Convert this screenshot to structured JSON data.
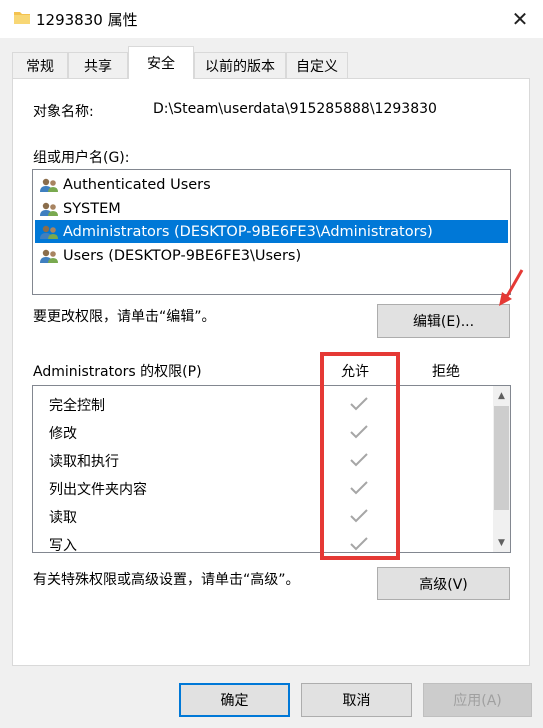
{
  "window": {
    "title": "1293830 属性",
    "close_glyph": "✕"
  },
  "tabs": [
    {
      "label": "常规"
    },
    {
      "label": "共享"
    },
    {
      "label": "安全"
    },
    {
      "label": "以前的版本"
    },
    {
      "label": "自定义"
    }
  ],
  "object": {
    "label": "对象名称:",
    "value": "D:\\Steam\\userdata\\915285888\\1293830"
  },
  "groups": {
    "label": "组或用户名(G):",
    "items": [
      {
        "label": "Authenticated Users"
      },
      {
        "label": "SYSTEM"
      },
      {
        "label": "Administrators (DESKTOP-9BE6FE3\\Administrators)"
      },
      {
        "label": "Users (DESKTOP-9BE6FE3\\Users)"
      }
    ],
    "selected_index": 2
  },
  "edit": {
    "hint": "要更改权限，请单击“编辑”。",
    "button": "编辑(E)..."
  },
  "permissions": {
    "label": "Administrators 的权限(P)",
    "allow_header": "允许",
    "deny_header": "拒绝",
    "rows": [
      {
        "name": "完全控制",
        "allow": true,
        "deny": false
      },
      {
        "name": "修改",
        "allow": true,
        "deny": false
      },
      {
        "name": "读取和执行",
        "allow": true,
        "deny": false
      },
      {
        "name": "列出文件夹内容",
        "allow": true,
        "deny": false
      },
      {
        "name": "读取",
        "allow": true,
        "deny": false
      },
      {
        "name": "写入",
        "allow": true,
        "deny": false
      }
    ]
  },
  "advanced": {
    "hint": "有关特殊权限或高级设置，请单击“高级”。",
    "button": "高级(V)"
  },
  "footer": {
    "ok": "确定",
    "cancel": "取消",
    "apply": "应用(A)"
  },
  "colors": {
    "selection": "#0078d7",
    "annotation": "#e53935",
    "check": "#a6a6a6"
  },
  "icons": [
    "folder-icon",
    "close-icon",
    "users-group-icon",
    "checkmark-icon",
    "scroll-up-icon",
    "scroll-down-icon",
    "annotation-arrow-icon"
  ]
}
